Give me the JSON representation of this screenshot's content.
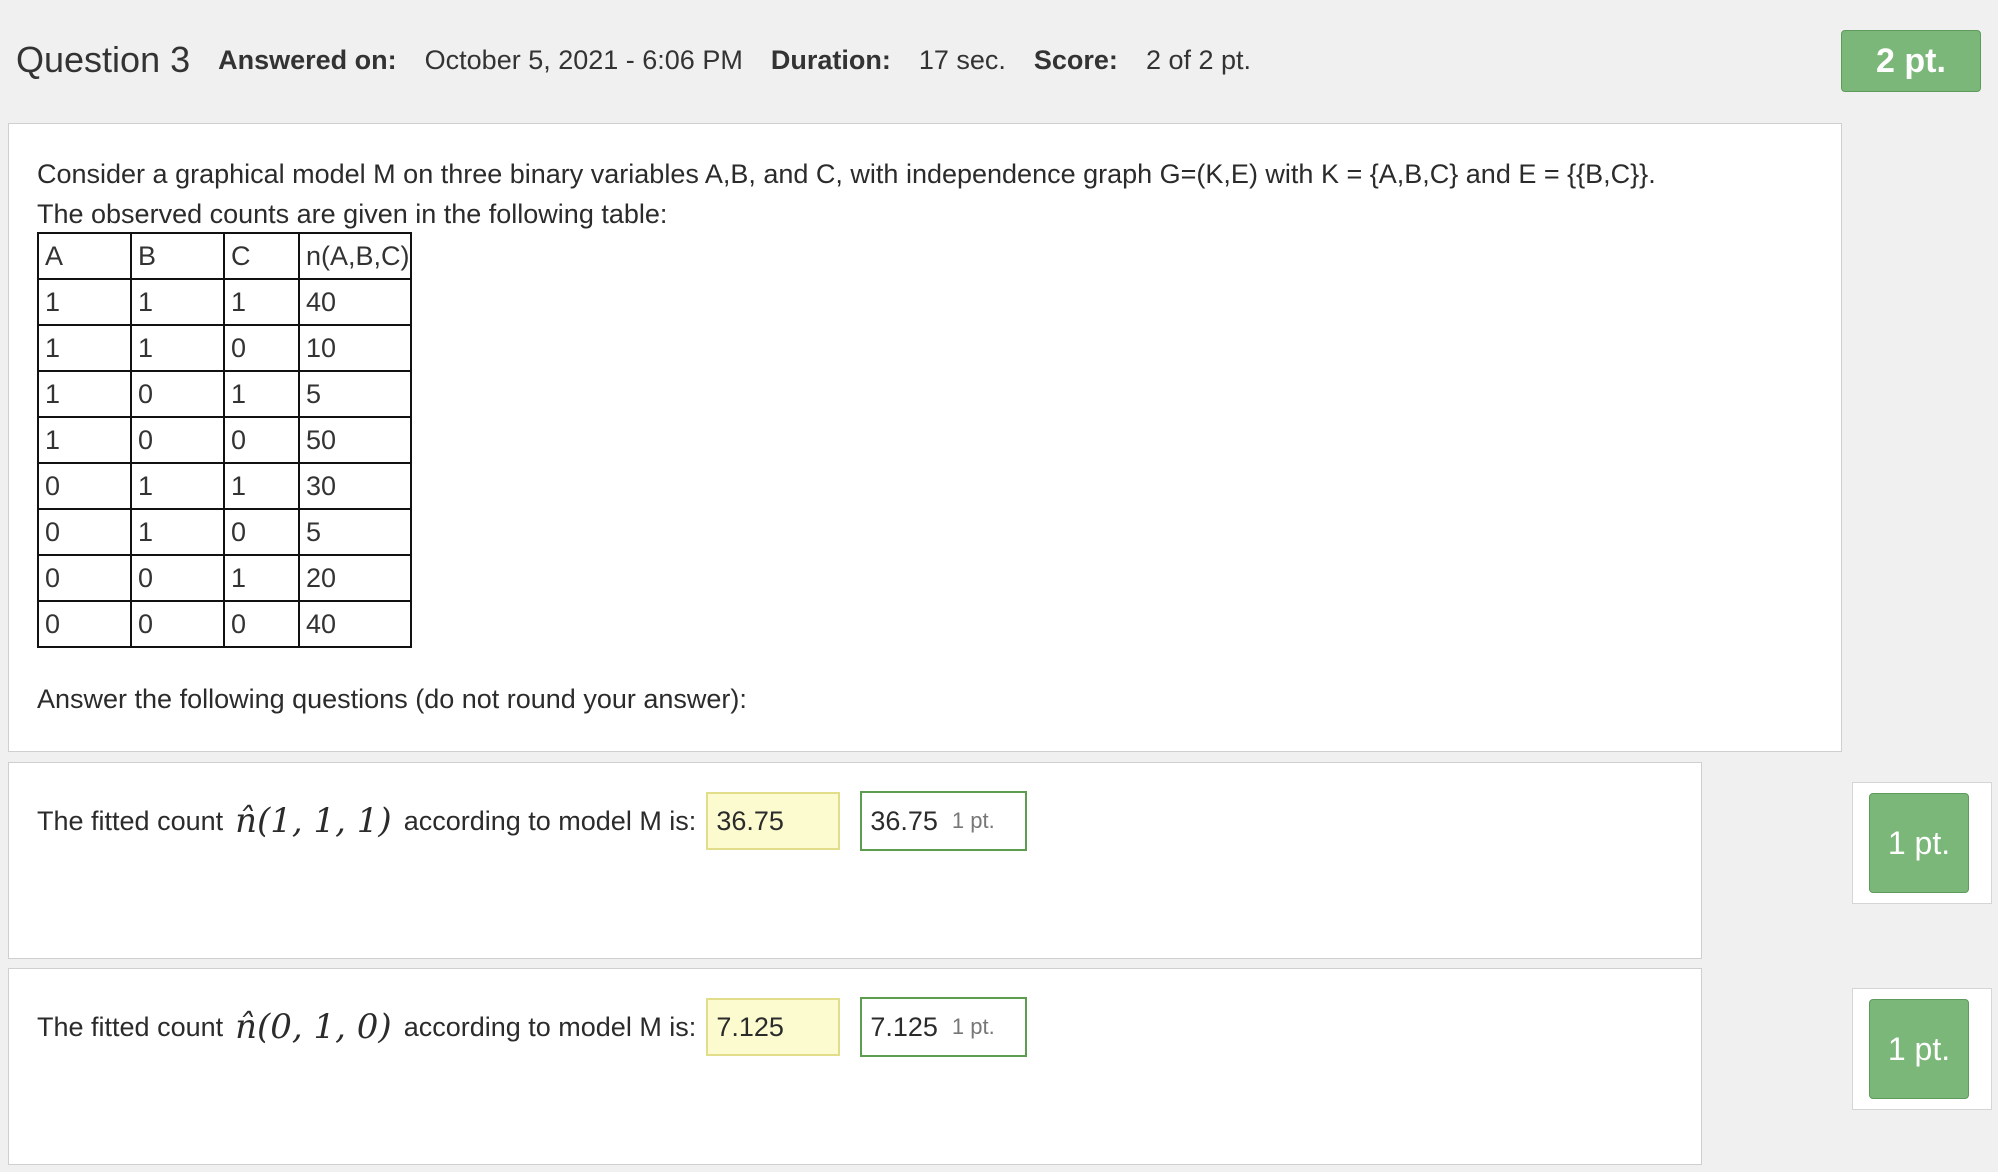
{
  "header": {
    "question_title": "Question 3",
    "answered_on_label": "Answered on:",
    "answered_on_value": "October 5, 2021 - 6:06 PM",
    "duration_label": "Duration:",
    "duration_value": "17 sec.",
    "score_label": "Score:",
    "score_value": "2 of 2 pt.",
    "total_badge": "2 pt."
  },
  "question": {
    "line1": "Consider a graphical model M on three binary variables A,B, and C, with independence graph G=(K,E) with K = {A,B,C} and E = {{B,C}}.",
    "line2": "The observed counts are given in the following table:",
    "table": {
      "headers": [
        "A",
        "B",
        "C",
        "n(A,B,C)"
      ],
      "rows": [
        [
          "1",
          "1",
          "1",
          "40"
        ],
        [
          "1",
          "1",
          "0",
          "10"
        ],
        [
          "1",
          "0",
          "1",
          "5"
        ],
        [
          "1",
          "0",
          "0",
          "50"
        ],
        [
          "0",
          "1",
          "1",
          "30"
        ],
        [
          "0",
          "1",
          "0",
          "5"
        ],
        [
          "0",
          "0",
          "1",
          "20"
        ],
        [
          "0",
          "0",
          "0",
          "40"
        ]
      ]
    },
    "instruction": "Answer the following questions (do not round your answer):"
  },
  "subquestions": [
    {
      "prefix": "The fitted count",
      "math": "n̂(1, 1, 1)",
      "suffix": "according to model M is:",
      "answer": "36.75",
      "correct_answer": "36.75",
      "correct_points": "1 pt.",
      "badge": "1 pt."
    },
    {
      "prefix": "The fitted count",
      "math": "n̂(0, 1, 0)",
      "suffix": "according to model M is:",
      "answer": "7.125",
      "correct_answer": "7.125",
      "correct_points": "1 pt.",
      "badge": "1 pt."
    }
  ],
  "colors": {
    "badge_green": "#7cb77a",
    "input_yellow": "#fbfbcf",
    "correct_border": "#5c9e4f"
  }
}
